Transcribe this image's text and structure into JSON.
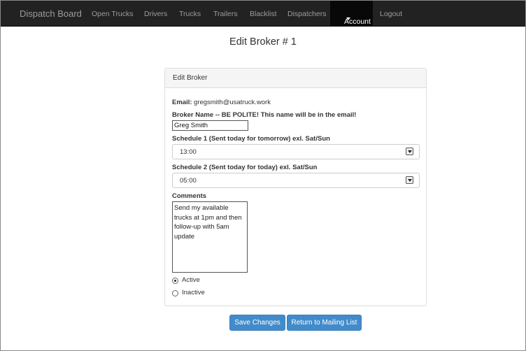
{
  "navbar": {
    "brand": "Dispatch Board",
    "items": [
      "Open Trucks",
      "Drivers",
      "Trucks",
      "Trailers",
      "Blacklist",
      "Dispatchers"
    ],
    "account": "Account",
    "logout": "Logout"
  },
  "page": {
    "title": "Edit Broker # 1"
  },
  "panel": {
    "heading": "Edit Broker"
  },
  "form": {
    "email_label": "Email:",
    "email_value": "gregsmith@usatruck.work",
    "broker_name_label": "Broker Name -- BE POLITE! This name will be in the email!",
    "broker_name_value": "Greg Smith",
    "schedule1_label": "Schedule 1 (Sent today for tomorrow) exl. Sat/Sun",
    "schedule1_value": "13:00",
    "schedule2_label": "Schedule 2 (Sent today for today) exl. Sat/Sun",
    "schedule2_value": "05:00",
    "comments_label": "Comments",
    "comments_value": "Send my available\ntrucks at 1pm and then\nfollow-up with 5am\nupdate",
    "status_options": [
      "Active",
      "Inactive"
    ],
    "status_selected": "Active"
  },
  "buttons": {
    "save": "Save Changes",
    "return": "Return to Mailing List"
  },
  "colors": {
    "navbar_bg": "#222222",
    "primary_button": "#428bca"
  }
}
